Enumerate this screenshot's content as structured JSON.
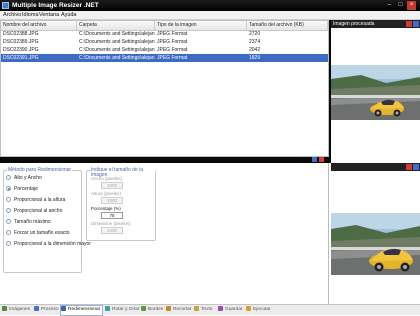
{
  "window": {
    "title": "Multiple Image Resizer .NET"
  },
  "menu": [
    "Archivo",
    "Idioma",
    "Ventana",
    "Ayuda"
  ],
  "files": {
    "columns": [
      "Nombre del archivo",
      "Carpeta",
      "Tipo de la imagen",
      "Tamaño del archivo (KB)"
    ],
    "rows": [
      [
        "DSC02388.JPG",
        "C:\\Documents and Settings\\alejan...",
        "JPEG Format",
        "2720"
      ],
      [
        "DSC02389.JPG",
        "C:\\Documents and Settings\\alejan...",
        "JPEG Format",
        "2374"
      ],
      [
        "DSC02390.JPG",
        "C:\\Documents and Settings\\alejan...",
        "JPEG Format",
        "2042"
      ],
      [
        "DSC02391.JPG",
        "C:\\Documents and Settings\\alejan...",
        "JPEG Format",
        "1829"
      ]
    ],
    "selected_row": 3
  },
  "preview": {
    "title": "Imagen procesada"
  },
  "resize": {
    "method_title": "Método para Redimensionar",
    "methods": [
      "Alto y Ancho",
      "Porcentaje",
      "Proporcional a la altura",
      "Proporcional al ancho",
      "Tamaño máximo",
      "Forzar un tamaño exacto",
      "Proporcional a la dimensión mayor"
    ],
    "selected_method": 1,
    "size_title": "Indique el tamaño de la imagen",
    "width_label": "Ancho (pixeles)",
    "width_value": "1000",
    "height_label": "Altura (pixeles)",
    "height_value": "1000",
    "percent_label": "Porcentaje (%)",
    "percent_value": "75",
    "dimension_label": "Dimensión (pixeles)",
    "dimension_value": "1000"
  },
  "tabs": [
    {
      "label": "Imágenes",
      "icon": "images-icon",
      "color": "#4f8f3a"
    },
    {
      "label": "Proceso",
      "icon": "process-icon",
      "color": "#3f73c9"
    },
    {
      "label": "Redimensionar",
      "icon": "resize-icon",
      "color": "#3b5fb0"
    },
    {
      "label": "Rotar y Girar",
      "icon": "rotate-icon",
      "color": "#3aa0a8"
    },
    {
      "label": "Bordes",
      "icon": "borders-icon",
      "color": "#5a9a3a"
    },
    {
      "label": "Recortar",
      "icon": "crop-icon",
      "color": "#c28a2a"
    },
    {
      "label": "Texto",
      "icon": "text-icon",
      "color": "#c9a43a"
    },
    {
      "label": "Guardar",
      "icon": "save-icon",
      "color": "#a04ab0"
    },
    {
      "label": "Ejecutar",
      "icon": "run-icon",
      "color": "#d8a02a"
    }
  ],
  "active_tab": 2
}
